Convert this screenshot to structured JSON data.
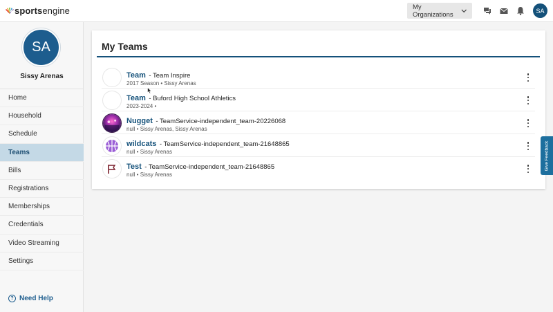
{
  "brand": {
    "name_bold": "sports",
    "name_light": "engine"
  },
  "header": {
    "org_button": "My Organizations",
    "avatar_initials": "SA"
  },
  "sidebar": {
    "avatar_initials": "SA",
    "user_name": "Sissy Arenas",
    "items": [
      {
        "label": "Home",
        "active": false
      },
      {
        "label": "Household",
        "active": false
      },
      {
        "label": "Schedule",
        "active": false
      },
      {
        "label": "Teams",
        "active": true
      },
      {
        "label": "Bills",
        "active": false
      },
      {
        "label": "Registrations",
        "active": false
      },
      {
        "label": "Memberships",
        "active": false
      },
      {
        "label": "Credentials",
        "active": false
      },
      {
        "label": "Video Streaming",
        "active": false
      },
      {
        "label": "Settings",
        "active": false
      }
    ],
    "help": "Need Help"
  },
  "main": {
    "title": "My Teams",
    "teams": [
      {
        "name": "Team",
        "org": "- Team Inspire",
        "sub": "2017 Season • Sissy Arenas",
        "logo": "blank"
      },
      {
        "name": "Team",
        "org": "- Buford High School Athletics",
        "sub": "2023-2024 •",
        "logo": "blank"
      },
      {
        "name": "Nugget",
        "org": "- TeamService-independent_team-20226068",
        "sub": "null • Sissy Arenas, Sissy Arenas",
        "logo": "photo"
      },
      {
        "name": "wildcats",
        "org": "- TeamService-independent_team-21648865",
        "sub": "null • Sissy Arenas",
        "logo": "basketball-icon"
      },
      {
        "name": "Test",
        "org": "- TeamService-independent_team-21648865",
        "sub": "null • Sissy Arenas",
        "logo": "flag-icon"
      }
    ]
  },
  "feedback": "Give Feedback",
  "colors": {
    "brand_blue": "#14517a",
    "active_nav": "#c4d9e6",
    "feedback_tab": "#1d6f9e"
  }
}
